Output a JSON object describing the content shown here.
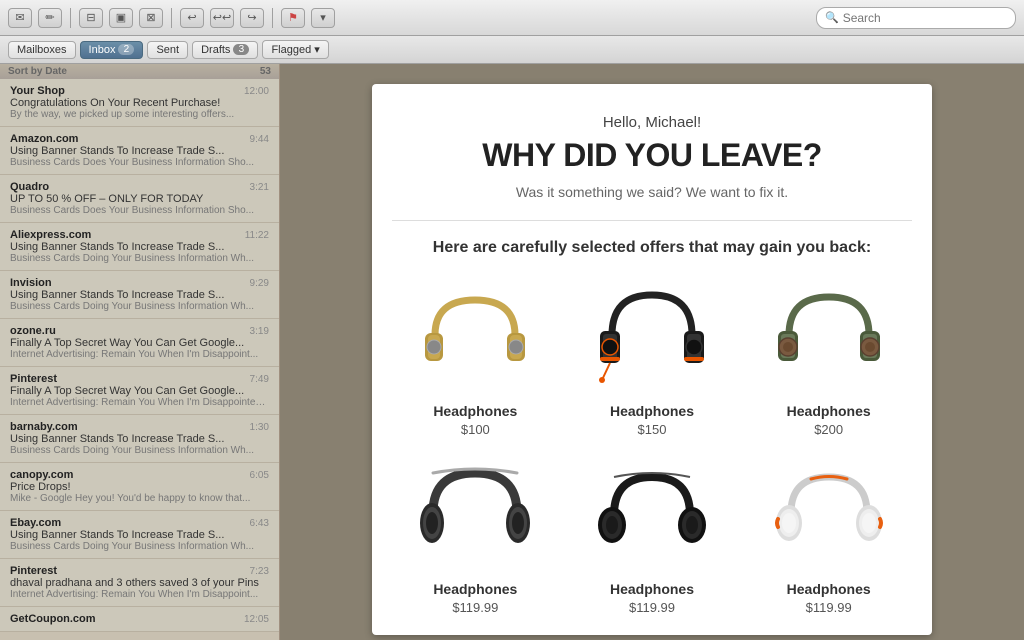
{
  "toolbar": {
    "search_placeholder": "Search",
    "icons": [
      "compose",
      "new-message",
      "delete",
      "archive",
      "move",
      "reply",
      "reply-all",
      "forward",
      "flag"
    ]
  },
  "mailbar": {
    "mailboxes_label": "Mailboxes",
    "inbox_label": "Inbox",
    "inbox_count": "2",
    "sent_label": "Sent",
    "drafts_label": "Drafts",
    "drafts_count": "3",
    "flagged_label": "Flagged"
  },
  "sidebar": {
    "section_label": "Sort by Date",
    "section_count": "53",
    "emails": [
      {
        "sender": "Your Shop",
        "time": "12:00",
        "subject": "Congratulations On Your Recent Purchase!",
        "preview": "By the way, we picked up some interesting offers..."
      },
      {
        "sender": "Amazon.com",
        "time": "9:44",
        "subject": "Using Banner Stands To Increase Trade S...",
        "preview": "Business Cards Does Your Business Information Sho..."
      },
      {
        "sender": "Quadro",
        "time": "3:21",
        "subject": "UP TO 50 % OFF – ONLY FOR TODAY",
        "preview": "Business Cards Does Your Business Information Sho..."
      },
      {
        "sender": "Aliexpress.com",
        "time": "11:22",
        "subject": "Using Banner Stands To Increase Trade S...",
        "preview": "Business Cards Doing Your Business Information Wh..."
      },
      {
        "sender": "Invision",
        "time": "9:29",
        "subject": "Using Banner Stands To Increase Trade S...",
        "preview": "Business Cards Doing Your Business Information Wh..."
      },
      {
        "sender": "ozone.ru",
        "time": "3:19",
        "subject": "Finally A Top Secret Way You Can Get Google...",
        "preview": "Internet Advertising: Remain You When I'm Disappoint..."
      },
      {
        "sender": "Pinterest",
        "time": "7:49",
        "subject": "Finally A Top Secret Way You Can Get Google...",
        "preview": "Internet Advertising: Remain You When I'm Disappointed..."
      },
      {
        "sender": "barnaby.com",
        "time": "1:30",
        "subject": "Using Banner Stands To Increase Trade S...",
        "preview": "Business Cards Doing Your Business Information Wh..."
      },
      {
        "sender": "canopy.com",
        "time": "6:05",
        "subject": "Price Drops!",
        "preview": "Mike - Google Hey you! You'd be happy to know that..."
      },
      {
        "sender": "Ebay.com",
        "time": "6:43",
        "subject": "Using Banner Stands To Increase Trade S...",
        "preview": "Business Cards Doing Your Business Information Wh..."
      },
      {
        "sender": "Pinterest",
        "time": "7:23",
        "subject": "dhaval pradhana and 3 others saved 3 of your Pins",
        "preview": "Internet Advertising: Remain You When I'm Disappoint..."
      },
      {
        "sender": "GetCoupon.com",
        "time": "12:05",
        "subject": "",
        "preview": ""
      }
    ]
  },
  "email": {
    "greeting": "Hello, Michael!",
    "headline": "WHY DID YOU LEAVE?",
    "subtext": "Was it something we said? We want to fix it.",
    "offers_title": "Here are carefully selected offers that may gain you back:",
    "products": [
      {
        "name": "Headphones",
        "price": "$100",
        "style": "gold",
        "id": "hp1"
      },
      {
        "name": "Headphones",
        "price": "$150",
        "style": "black-orange",
        "id": "hp2"
      },
      {
        "name": "Headphones",
        "price": "$200",
        "style": "green-brown",
        "id": "hp3"
      },
      {
        "name": "Headphones",
        "price": "$119.99",
        "style": "black-silver",
        "id": "hp4"
      },
      {
        "name": "Headphones",
        "price": "$119.99",
        "style": "black-leather",
        "id": "hp5"
      },
      {
        "name": "Headphones",
        "price": "$119.99",
        "style": "white-orange",
        "id": "hp6"
      }
    ]
  }
}
